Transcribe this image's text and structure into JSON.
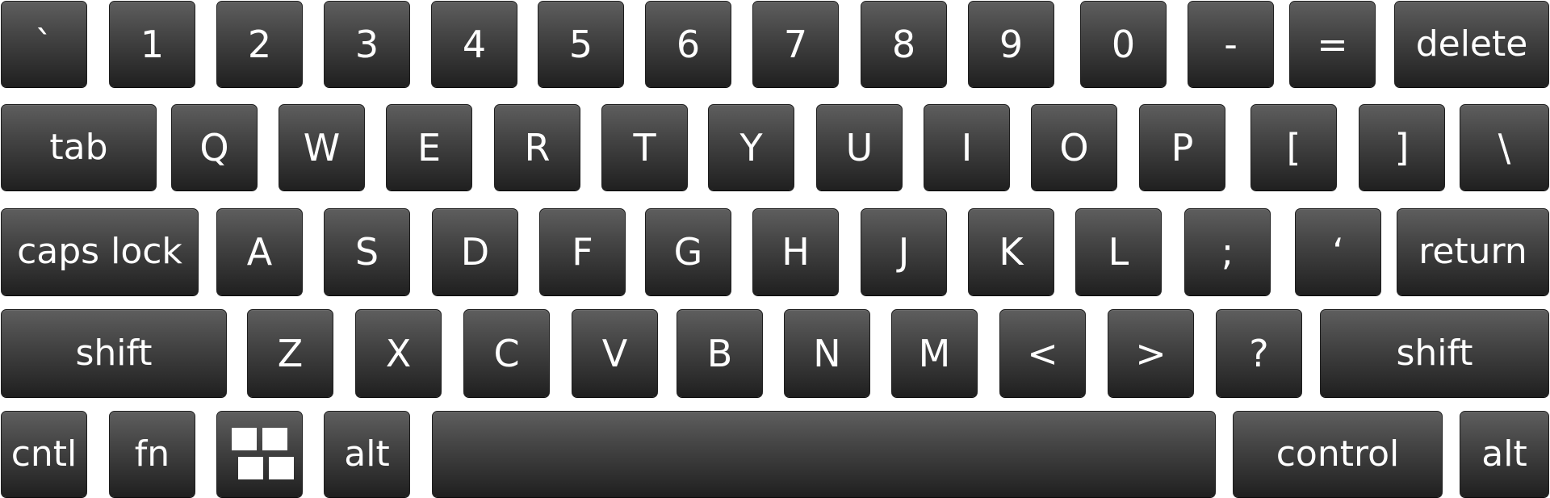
{
  "keyboard": {
    "row1": [
      "`",
      "1",
      "2",
      "3",
      "4",
      "5",
      "6",
      "7",
      "8",
      "9",
      "0",
      "-",
      "=",
      "delete"
    ],
    "row2": [
      "tab",
      "Q",
      "W",
      "E",
      "R",
      "T",
      "Y",
      "U",
      "I",
      "O",
      "P",
      "[",
      "]",
      "\\"
    ],
    "row3": [
      "caps lock",
      "A",
      "S",
      "D",
      "F",
      "G",
      "H",
      "J",
      "K",
      "L",
      ";",
      "‘",
      "return"
    ],
    "row4": [
      "shift",
      "Z",
      "X",
      "C",
      "V",
      "B",
      "N",
      "M",
      "<",
      ">",
      "?",
      "shift"
    ],
    "row5": {
      "cntl": "cntl",
      "fn": "fn",
      "os_icon": "four-squares-icon",
      "alt_left": "alt",
      "space": "",
      "control": "control",
      "alt_right": "alt"
    }
  },
  "colors": {
    "key_top": "#5e5e5e",
    "key_bottom": "#202020",
    "label": "#ffffff",
    "background": "#ffffff"
  }
}
